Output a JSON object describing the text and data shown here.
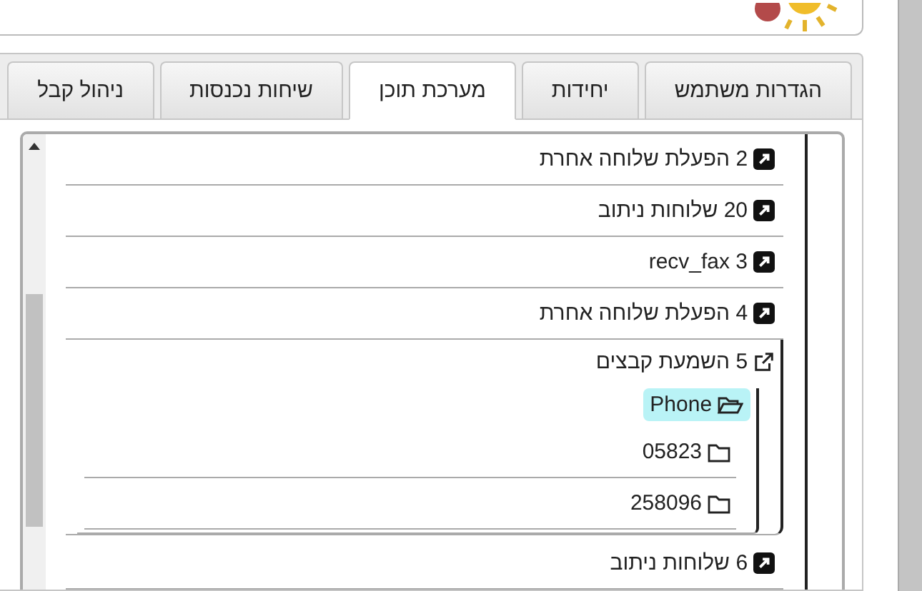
{
  "tabs": [
    {
      "label": "הגדרות משתמש",
      "selected": false
    },
    {
      "label": "יחידות",
      "selected": false
    },
    {
      "label": "מערכת תוכן",
      "selected": true
    },
    {
      "label": "שיחות נכנסות",
      "selected": false
    },
    {
      "label": "ניהול קבל",
      "selected": false
    }
  ],
  "tree": [
    {
      "kind": "link",
      "label": "2 הפעלת שלוחה אחרת"
    },
    {
      "kind": "link",
      "label": "20 שלוחות ניתוב"
    },
    {
      "kind": "link",
      "label": "recv_fax 3"
    },
    {
      "kind": "link",
      "label": "4 הפעלת שלוחה אחרת"
    },
    {
      "kind": "group",
      "label": "5 השמעת קבצים",
      "expanded": true,
      "children": [
        {
          "label": "Phone",
          "selected": true,
          "expanded": true,
          "children": [
            {
              "label": "05823",
              "selected": false
            },
            {
              "label": "258096",
              "selected": false
            }
          ]
        }
      ]
    },
    {
      "kind": "link",
      "label": "6 שלוחות ניתוב"
    }
  ]
}
